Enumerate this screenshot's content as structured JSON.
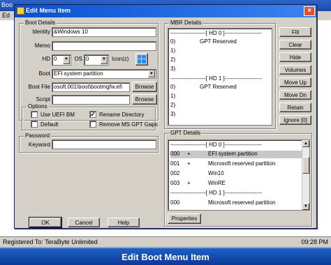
{
  "background": {
    "title": "Boo",
    "menu_label": "Ed",
    "status_left": "Registered To: TeraByte Unlimited",
    "status_right": "09:28 PM",
    "caption": "Edit Boot Menu Item"
  },
  "dialog": {
    "title": "Edit Menu Item",
    "boot_details": {
      "group_label": "Boot Details",
      "identity_label": "Identity",
      "identity_value": "&Windows 10",
      "memo_label": "Memo",
      "memo_value": "",
      "hd_label": "HD",
      "hd_value": "0",
      "os_label": "OS",
      "os_value": "0",
      "icon_label": "Icon(z)",
      "boot_label": "Boot",
      "boot_value": "EFI system partition",
      "boot_file_label": "Boot File",
      "boot_file_value": "osoft.001\\boot\\bootmgfw.efi",
      "script_label": "Script",
      "script_value": "",
      "browse_label": "Browse"
    },
    "options": {
      "group_label": "Options",
      "items": [
        {
          "label": "Use UEFI BM",
          "checked": false
        },
        {
          "label": "Rename Directory",
          "checked": true
        },
        {
          "label": "Default",
          "checked": false
        },
        {
          "label": "Remove MS GPT Gaps",
          "checked": false
        }
      ]
    },
    "password": {
      "group_label": "Password",
      "keyword_label": "Keyword",
      "keyword_value": ""
    },
    "mbr_details": {
      "group_label": "MBR Details",
      "rows": [
        {
          "kind": "sep",
          "text": "-------------------[ HD 0 ]--------------------"
        },
        {
          "kind": "row",
          "num": "0)",
          "name": "GPT Reserved"
        },
        {
          "kind": "row",
          "num": "1)",
          "name": ""
        },
        {
          "kind": "row",
          "num": "2)",
          "name": ""
        },
        {
          "kind": "row",
          "num": "3)",
          "name": ""
        },
        {
          "kind": "sep",
          "text": "-------------------[ HD 1 ]--------------------"
        },
        {
          "kind": "row",
          "num": "0)",
          "name": "GPT Reserved"
        },
        {
          "kind": "row",
          "num": "1)",
          "name": ""
        },
        {
          "kind": "row",
          "num": "2)",
          "name": ""
        },
        {
          "kind": "row",
          "num": "3)",
          "name": ""
        }
      ]
    },
    "side_buttons": [
      {
        "label": "Fill",
        "enabled": true
      },
      {
        "label": "Clear",
        "enabled": true
      },
      {
        "label": "Hide",
        "enabled": true
      },
      {
        "label": "Volumes",
        "enabled": true
      },
      {
        "label": "Move Up",
        "enabled": true
      },
      {
        "label": "Move Dn",
        "enabled": true
      },
      {
        "label": "Retain",
        "enabled": true
      },
      {
        "label": "Ignore [0]",
        "enabled": true
      }
    ],
    "gpt_details": {
      "group_label": "GPT Details",
      "rows": [
        {
          "kind": "sep",
          "text": "-------------------[ HD 0 ]--------------------"
        },
        {
          "kind": "row",
          "num": "000",
          "flag": "+",
          "name": "EFI system partition",
          "selected": true
        },
        {
          "kind": "row",
          "num": "001",
          "flag": "+",
          "name": "Microsoft reserved partition"
        },
        {
          "kind": "row",
          "num": "002",
          "flag": "",
          "name": "Win10"
        },
        {
          "kind": "row",
          "num": "003",
          "flag": "+",
          "name": "WinRE"
        },
        {
          "kind": "sep",
          "text": "-------------------[ HD 1 ]--------------------"
        },
        {
          "kind": "row",
          "num": "000",
          "flag": "",
          "name": "Microsoft reserved partition"
        }
      ],
      "properties_label": "Properties"
    },
    "ok_label": "OK",
    "cancel_label": "Cancel",
    "help_label": "Help"
  }
}
